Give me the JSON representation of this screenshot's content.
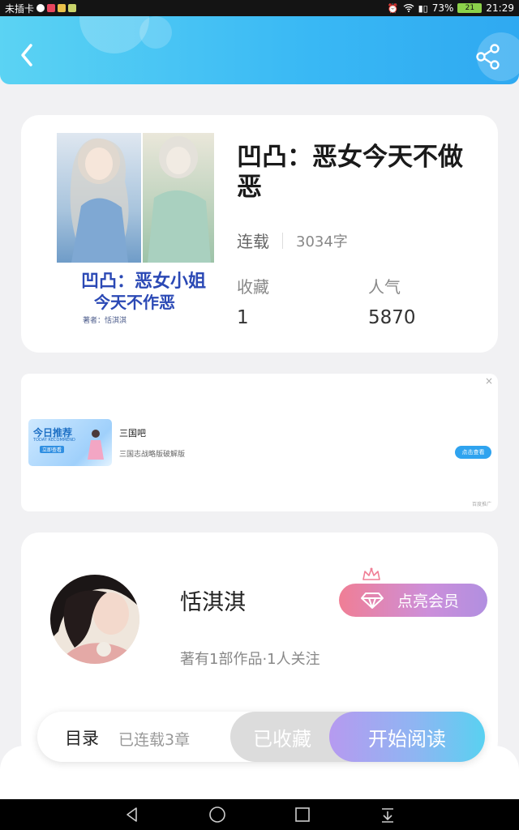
{
  "status_bar": {
    "carrier": "未插卡",
    "battery": "73%",
    "battery_level": "21",
    "time": "21:29"
  },
  "book": {
    "title": "凹凸：恶女今天不做恶",
    "status": "连载",
    "word_count": "3034字",
    "favorites_label": "收藏",
    "favorites_value": "1",
    "popularity_label": "人气",
    "popularity_value": "5870",
    "cover_text_line1": "凹凸：恶女小姐",
    "cover_text_line2": "今天不作恶",
    "cover_author": "著者：恬淇淇"
  },
  "ad": {
    "image_title": "今日推荐",
    "image_subtitle": "TODAY RECOMMEND",
    "image_button": "立即查看",
    "name": "三国吧",
    "description": "三国志战略版破解版",
    "button": "点击查看",
    "mark": "百度推广",
    "close": "×"
  },
  "author": {
    "name": "恬淇淇",
    "meta": "著有1部作品·1人关注",
    "member_button": "点亮会员"
  },
  "bottom_bar": {
    "toc_label": "目录",
    "chapters": "已连载3章",
    "collected": "已收藏",
    "start_reading": "开始阅读"
  },
  "colors": {
    "header": "#39b8f4",
    "read_button_start": "#b69af0",
    "read_button_end": "#59d1f1",
    "member_button": "#f07e95"
  },
  "icons": {
    "back": "back-arrow-icon",
    "share": "share-icon",
    "nav_back": "triangle-back-icon",
    "nav_home": "circle-home-icon",
    "nav_recent": "square-recent-icon",
    "nav_down": "notification-down-icon"
  }
}
